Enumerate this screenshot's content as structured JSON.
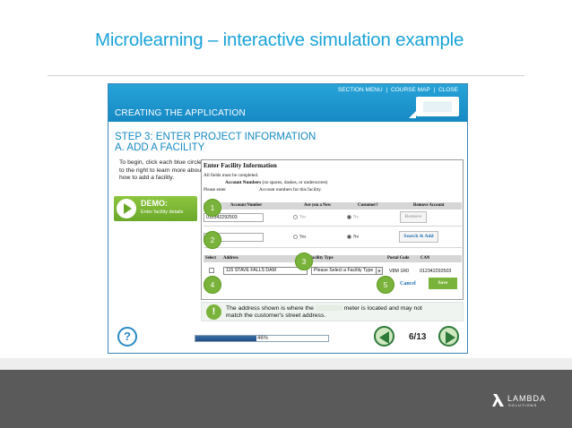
{
  "slide": {
    "title": "Microlearning – interactive simulation example"
  },
  "module": {
    "nav": {
      "section_menu": "SECTION MENU",
      "separator": "|",
      "course_map": "COURSE MAP",
      "close": "CLOSE"
    },
    "section_title": "CREATING THE APPLICATION",
    "step_title_1": "STEP 3: ENTER PROJECT INFORMATION",
    "step_title_2": "A. ADD A FACILITY",
    "instructions": "To begin, click each blue circle to the right to learn more about how to add a facility.",
    "demo": {
      "label": "DEMO:",
      "sublabel": "Enter facility details"
    },
    "form": {
      "title": "Enter Facility Information",
      "line1": "All fields must be completed.",
      "line2_bold": "Account Numbers",
      "line2_rest": " (no spaces, dashes, or underscores)",
      "line3_start": "Please enter",
      "line3_end": "Account numbers for this facility.",
      "acct_headers": [
        "Account Number",
        "Are you a New",
        "Customer?",
        "Remove Account"
      ],
      "row1": {
        "account": "012342292503",
        "yes": "Yes",
        "no": "No",
        "button": "Remove"
      },
      "row2": {
        "account": "",
        "yes": "Yes",
        "no": "No",
        "button": "Search & Add"
      },
      "addr_headers": [
        "Select",
        "Address",
        "Facility Type",
        "Postal Code",
        "CAN"
      ],
      "addr_row": {
        "address": "115 STAVE FALLS DAM",
        "facility_type": "Please Select a Facility Type",
        "postal_code": "V8M 1R0",
        "can": "012342292503"
      },
      "cancel": "Cancel",
      "save": "Save"
    },
    "hotspots": [
      "1",
      "2",
      "3",
      "4",
      "5"
    ],
    "note": {
      "icon": "!",
      "text_start": "The address shown is where the",
      "text_end": "meter is located and may not match the customer's street address."
    },
    "bottom": {
      "help_icon": "?",
      "progress_percent": 46,
      "progress_label": "46%",
      "page_count": "6/13"
    }
  },
  "footer": {
    "logo_text": "LAMBDA",
    "logo_sub": "SOLUTIONS"
  },
  "colors": {
    "title_blue": "#1aa3d8",
    "module_blue": "#1689c4",
    "accent_green": "#7ab33b",
    "footer_gray": "#5a5a5a"
  }
}
